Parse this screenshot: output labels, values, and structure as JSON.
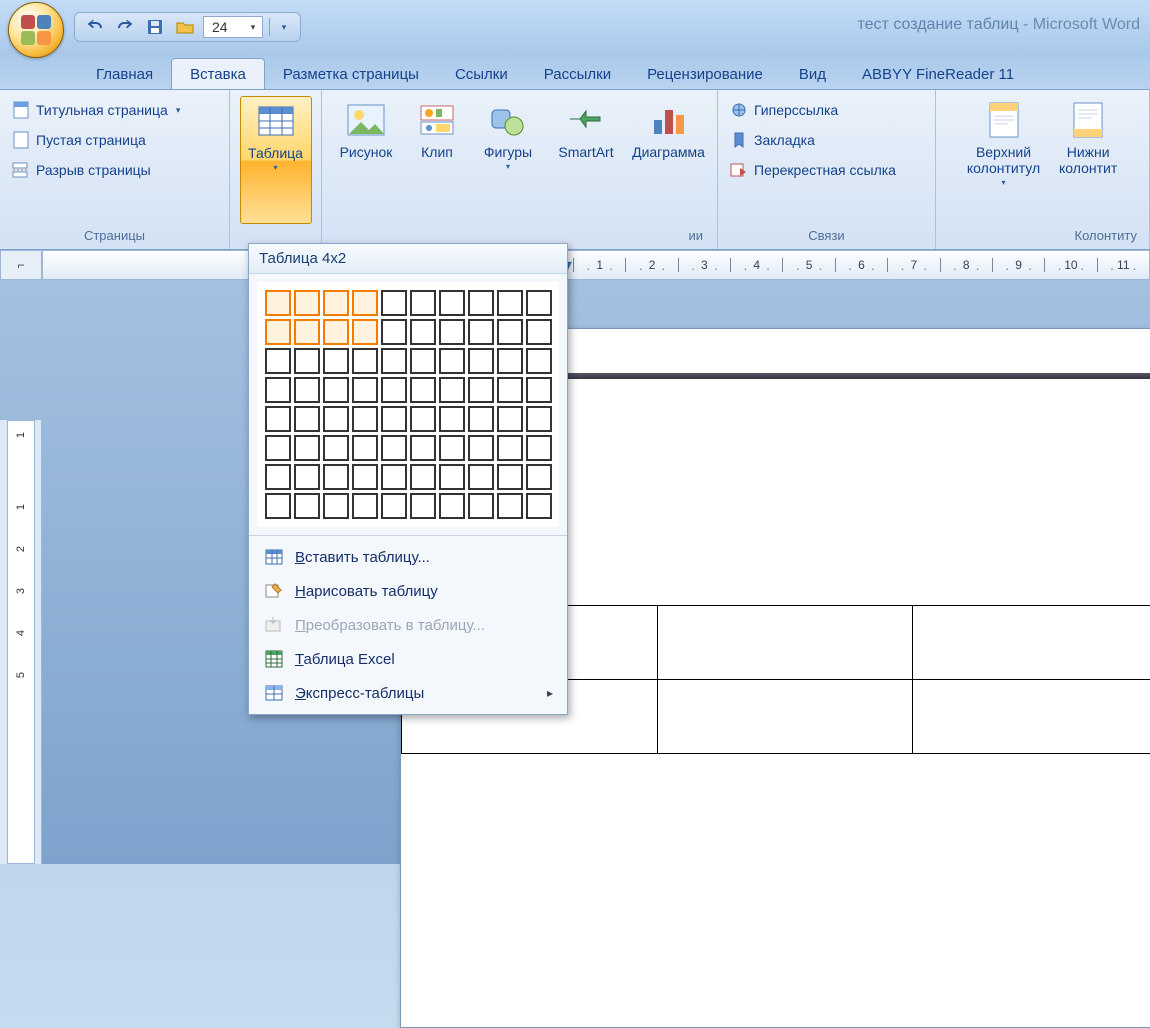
{
  "title": {
    "document": "тест создание таблиц",
    "app": "Microsoft Word"
  },
  "qat": {
    "font_size": "24"
  },
  "tabs": [
    {
      "label": "Главная",
      "active": false
    },
    {
      "label": "Вставка",
      "active": true
    },
    {
      "label": "Разметка страницы",
      "active": false
    },
    {
      "label": "Ссылки",
      "active": false
    },
    {
      "label": "Рассылки",
      "active": false
    },
    {
      "label": "Рецензирование",
      "active": false
    },
    {
      "label": "Вид",
      "active": false
    },
    {
      "label": "ABBYY FineReader 11",
      "active": false
    }
  ],
  "ribbon": {
    "pages": {
      "label": "Страницы",
      "items": [
        {
          "label": "Титульная страница"
        },
        {
          "label": "Пустая страница"
        },
        {
          "label": "Разрыв страницы"
        }
      ]
    },
    "tables": {
      "label": "Таблица"
    },
    "illus": {
      "label_partial": "ии",
      "items": [
        {
          "label": "Рисунок"
        },
        {
          "label": "Клип"
        },
        {
          "label": "Фигуры"
        },
        {
          "label": "SmartArt"
        },
        {
          "label": "Диаграмма"
        }
      ]
    },
    "links": {
      "label": "Связи",
      "items": [
        {
          "label": "Гиперссылка"
        },
        {
          "label": "Закладка"
        },
        {
          "label": "Перекрестная ссылка"
        }
      ]
    },
    "headers": {
      "label": "Колонтиту",
      "items": [
        {
          "label": "Верхний\nколонтитул"
        },
        {
          "label": "Нижни\nколонтит"
        }
      ]
    }
  },
  "table_dropdown": {
    "header": "Таблица 4x2",
    "grid": {
      "cols": 10,
      "rows": 8,
      "sel_cols": 4,
      "sel_rows": 2
    },
    "menu": [
      {
        "icon": "table-icon",
        "label": "Вставить таблицу...",
        "underline": 0,
        "enabled": true
      },
      {
        "icon": "draw-icon",
        "label": "Нарисовать таблицу",
        "underline": 0,
        "enabled": true
      },
      {
        "icon": "convert-icon",
        "label": "Преобразовать в таблицу...",
        "underline": 0,
        "enabled": false
      },
      {
        "icon": "excel-icon",
        "label": "Таблица Excel",
        "underline": 0,
        "enabled": true
      },
      {
        "icon": "quick-icon",
        "label": "Экспресс-таблицы",
        "underline": 0,
        "enabled": true,
        "submenu": true
      }
    ]
  },
  "ruler": {
    "h_numbers": [
      "1",
      "2",
      "3",
      "4",
      "5",
      "6",
      "7",
      "8",
      "9",
      "10",
      "11"
    ],
    "v_numbers": [
      "1",
      "",
      "1",
      "2",
      "3",
      "4",
      "5"
    ]
  },
  "doc_table": {
    "cols": 3,
    "rows": 2
  }
}
